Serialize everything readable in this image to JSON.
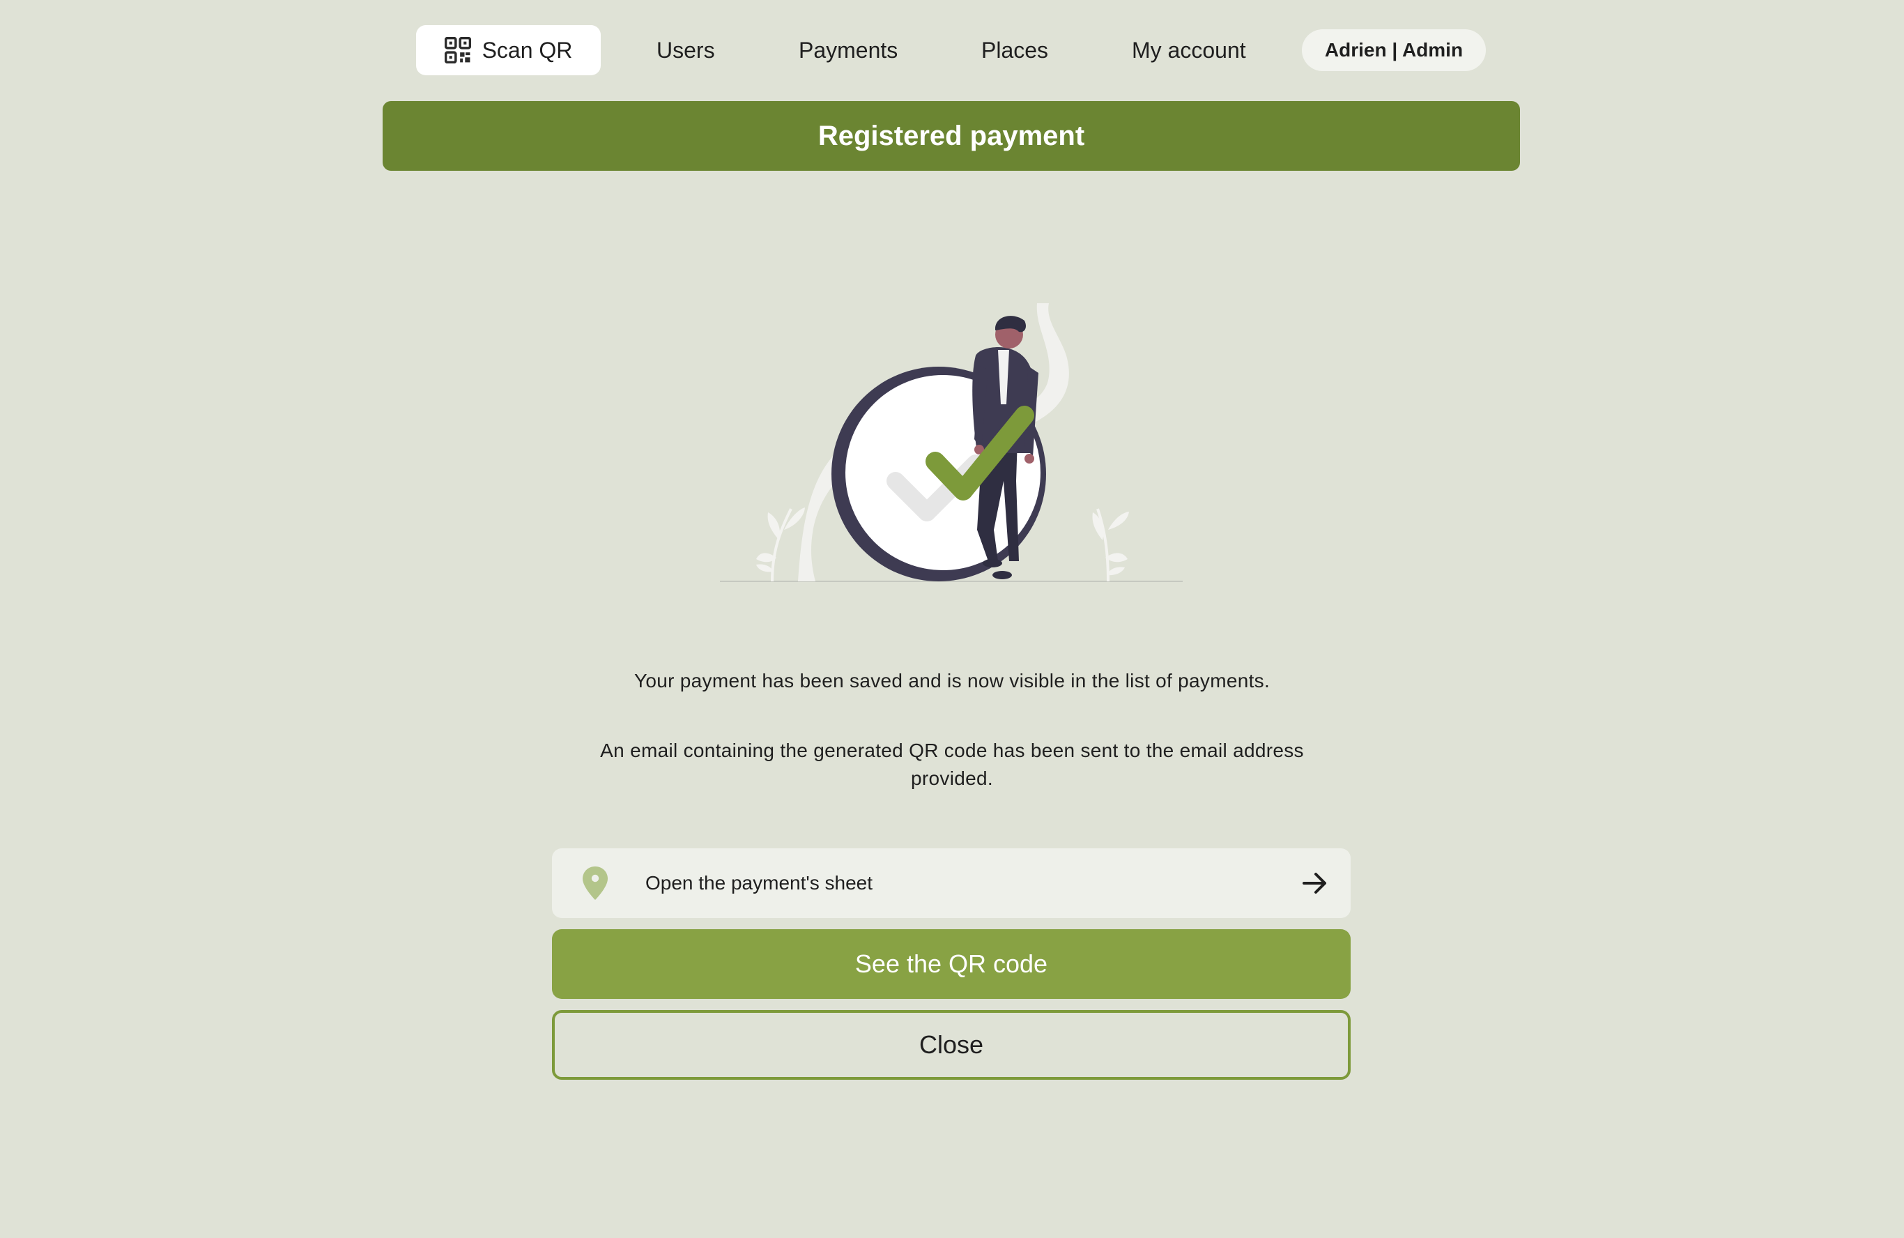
{
  "nav": {
    "scan_label": "Scan QR",
    "users_label": "Users",
    "payments_label": "Payments",
    "places_label": "Places",
    "account_label": "My account",
    "user_badge": "Adrien | Admin"
  },
  "header": {
    "title": "Registered payment"
  },
  "messages": {
    "saved": "Your payment has been saved and is now visible in the list of payments.",
    "email": "An email containing the generated QR code has been sent to the email address provided."
  },
  "actions": {
    "open_sheet_label": "Open the payment's sheet",
    "see_qr_label": "See the QR code",
    "close_label": "Close"
  },
  "icons": {
    "scan": "qr-code-icon",
    "pin": "map-pin-icon",
    "arrow": "arrow-right-icon",
    "illustration": "success-checkmark-illustration"
  },
  "colors": {
    "background": "#dfe2d6",
    "primary": "#6b8532",
    "accent": "#88a244",
    "nav_active_bg": "#ffffff"
  }
}
